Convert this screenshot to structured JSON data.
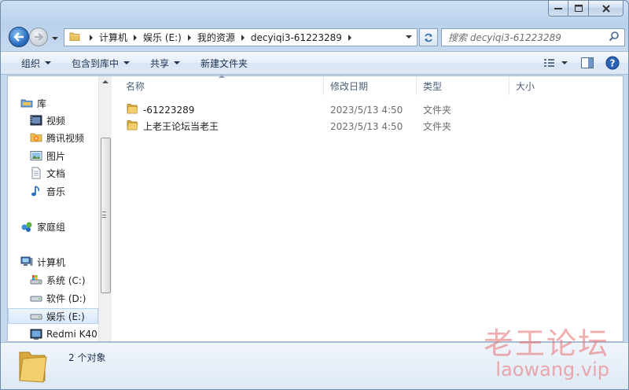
{
  "address": {
    "crumbs": [
      "计算机",
      "娱乐 (E:)",
      "我的资源",
      "decyiqi3-61223289"
    ]
  },
  "search": {
    "placeholder": "搜索 decyiqi3-61223289"
  },
  "toolbar": {
    "organize": "组织",
    "include_in_library": "包含到库中",
    "share": "共享",
    "new_folder": "新建文件夹"
  },
  "nav": {
    "libraries": "库",
    "videos": "视频",
    "tencent_video": "腾讯视频",
    "pictures": "图片",
    "documents": "文档",
    "music": "音乐",
    "homegroup": "家庭组",
    "computer": "计算机",
    "drive_c": "系统 (C:)",
    "drive_d": "软件 (D:)",
    "drive_e": "娱乐 (E:)",
    "device": "Redmi K40"
  },
  "columns": {
    "name": "名称",
    "date": "修改日期",
    "type": "类型",
    "size": "大小"
  },
  "files": [
    {
      "name": "-61223289",
      "date": "2023/5/13 4:50",
      "type": "文件夹"
    },
    {
      "name": "上老王论坛当老王",
      "date": "2023/5/13 4:50",
      "type": "文件夹"
    }
  ],
  "details": {
    "count": "2 个对象"
  },
  "watermark": {
    "title": "老王论坛",
    "url": "laowang.vip"
  },
  "colors": {
    "accent": "#1d4f95",
    "folder": "#e8c25a",
    "watermark": "#e86c6c"
  }
}
